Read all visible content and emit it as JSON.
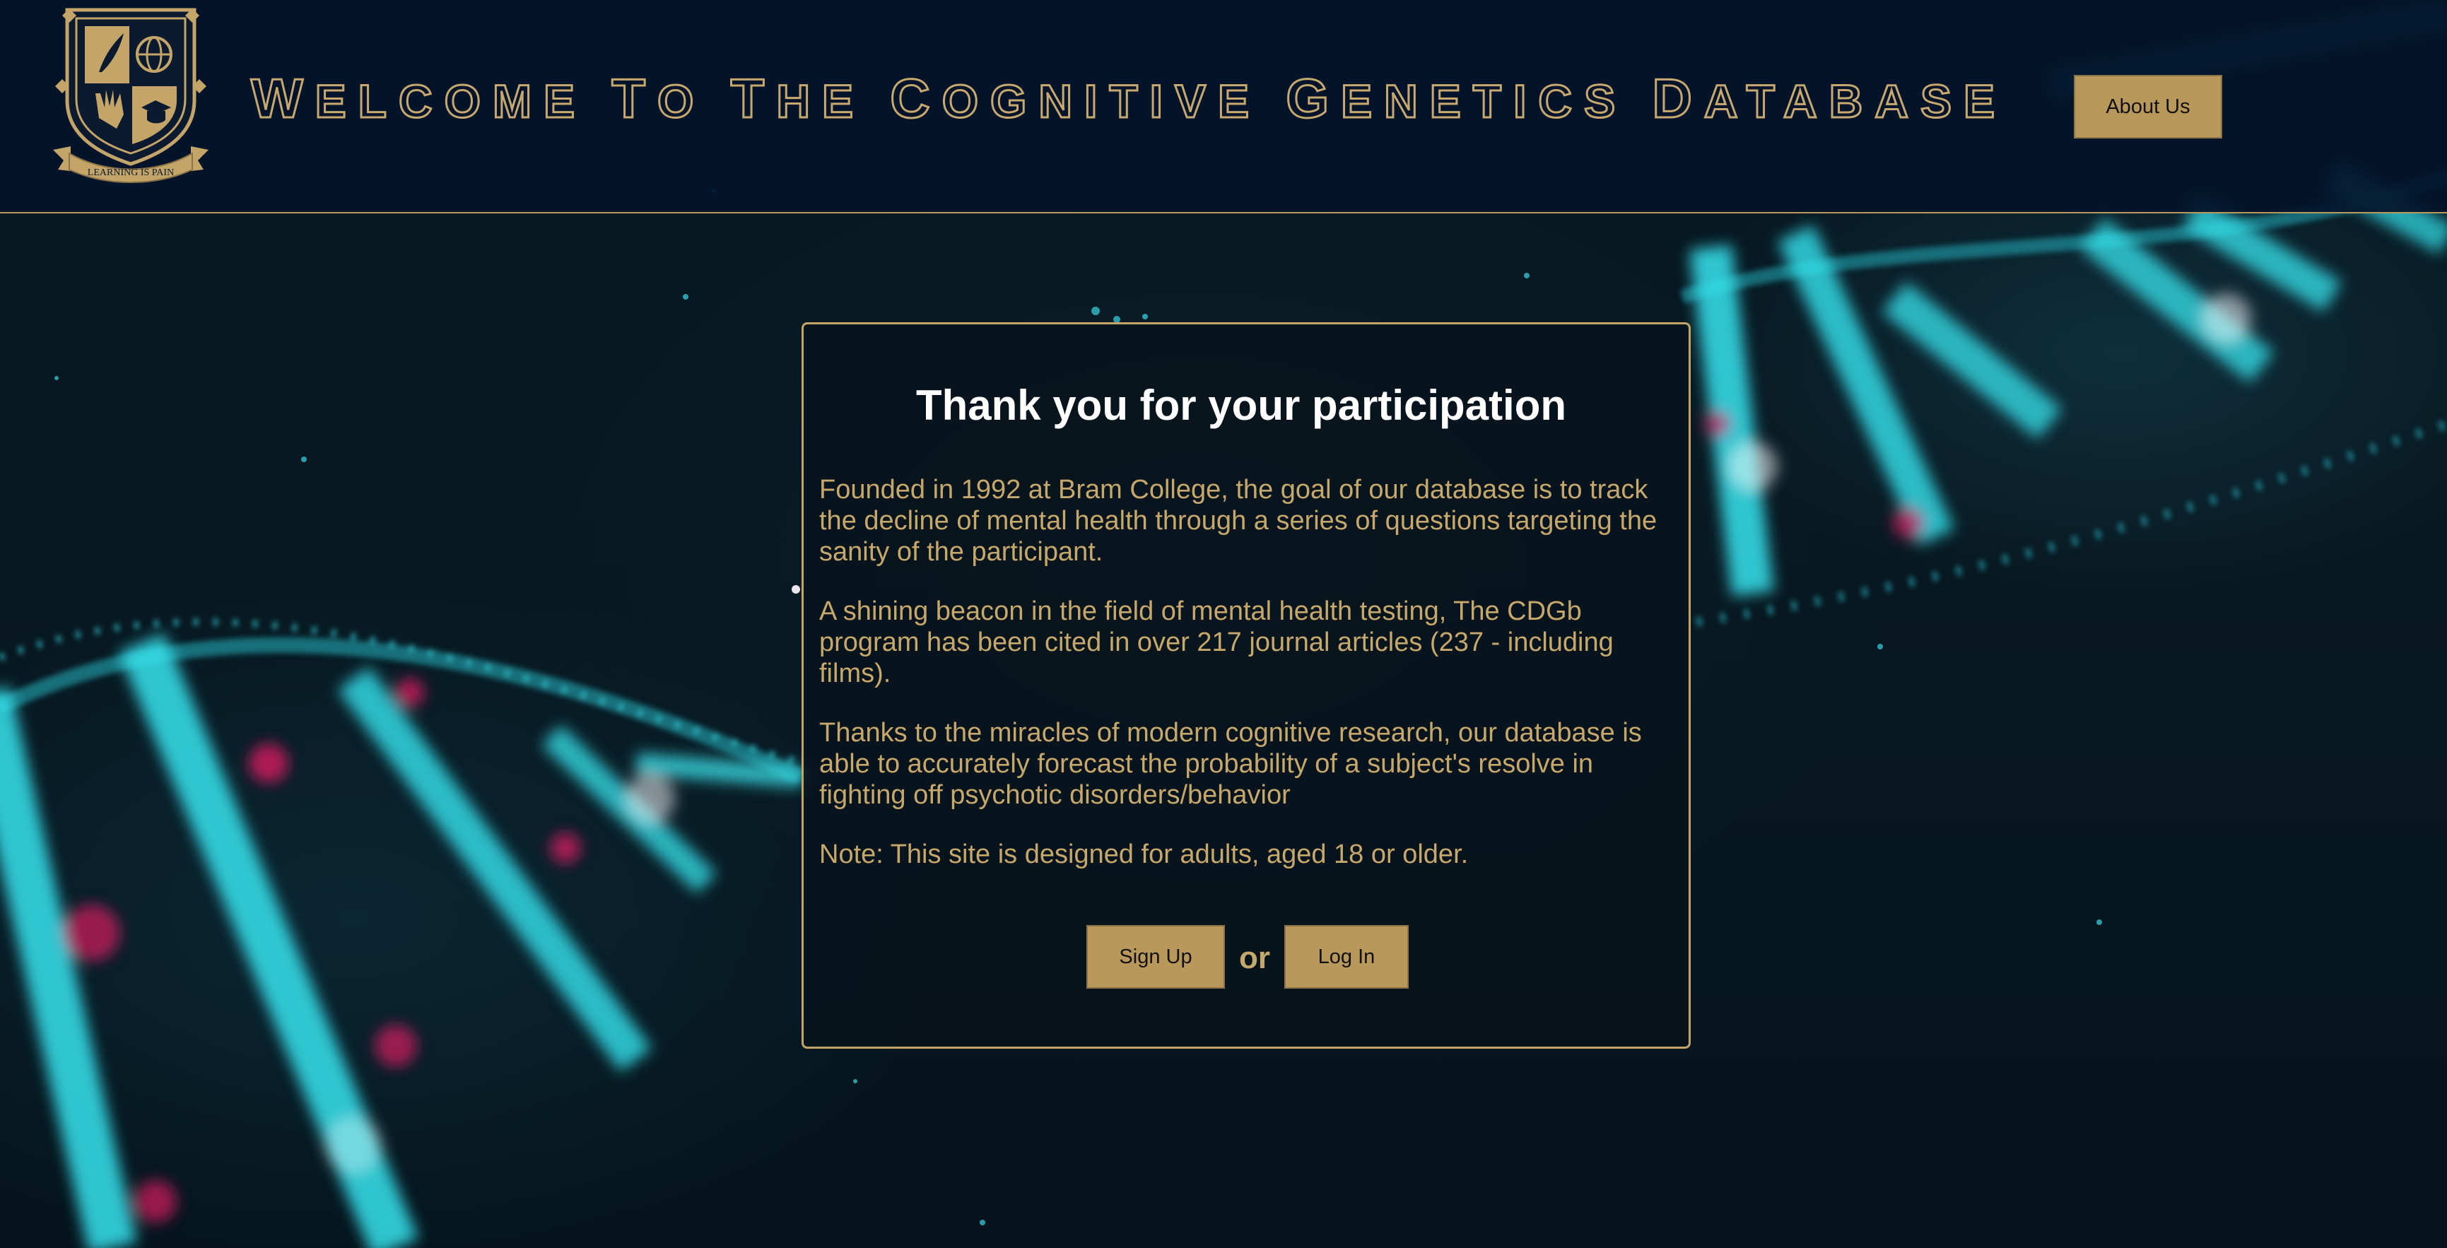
{
  "header": {
    "title_words": [
      {
        "first": "W",
        "rest": "elcome"
      },
      {
        "first": "T",
        "rest": "o"
      },
      {
        "first": "T",
        "rest": "he"
      },
      {
        "first": "C",
        "rest": "ognitive"
      },
      {
        "first": "G",
        "rest": "enetics"
      },
      {
        "first": "D",
        "rest": "atabase"
      }
    ],
    "title": "Welcome To The Cognitive Genetics Database",
    "about_label": "About Us",
    "crest_motto": "LEARNING IS PAIN"
  },
  "card": {
    "heading": "Thank you for your participation",
    "paragraphs": [
      "Founded in 1992 at Bram College, the goal of our database is to track the decline of mental health through a series of questions targeting the sanity of the participant.",
      "A shining beacon in the field of mental health testing, The CDGb program has been cited in over 217 journal articles (237 - including films).",
      "Thanks to the miracles of modern cognitive research, our database is able to accurately forecast the probability of a subject's resolve in fighting off psychotic disorders/behavior",
      "Note: This site is designed for adults, aged 18 or older."
    ],
    "signup_label": "Sign Up",
    "or_label": "or",
    "login_label": "Log In"
  },
  "colors": {
    "gold": "#c4a569",
    "button": "#b9985c",
    "header_bg": "#03142a",
    "helix": "#2fe3ec",
    "accent_pink": "#d8195f"
  }
}
